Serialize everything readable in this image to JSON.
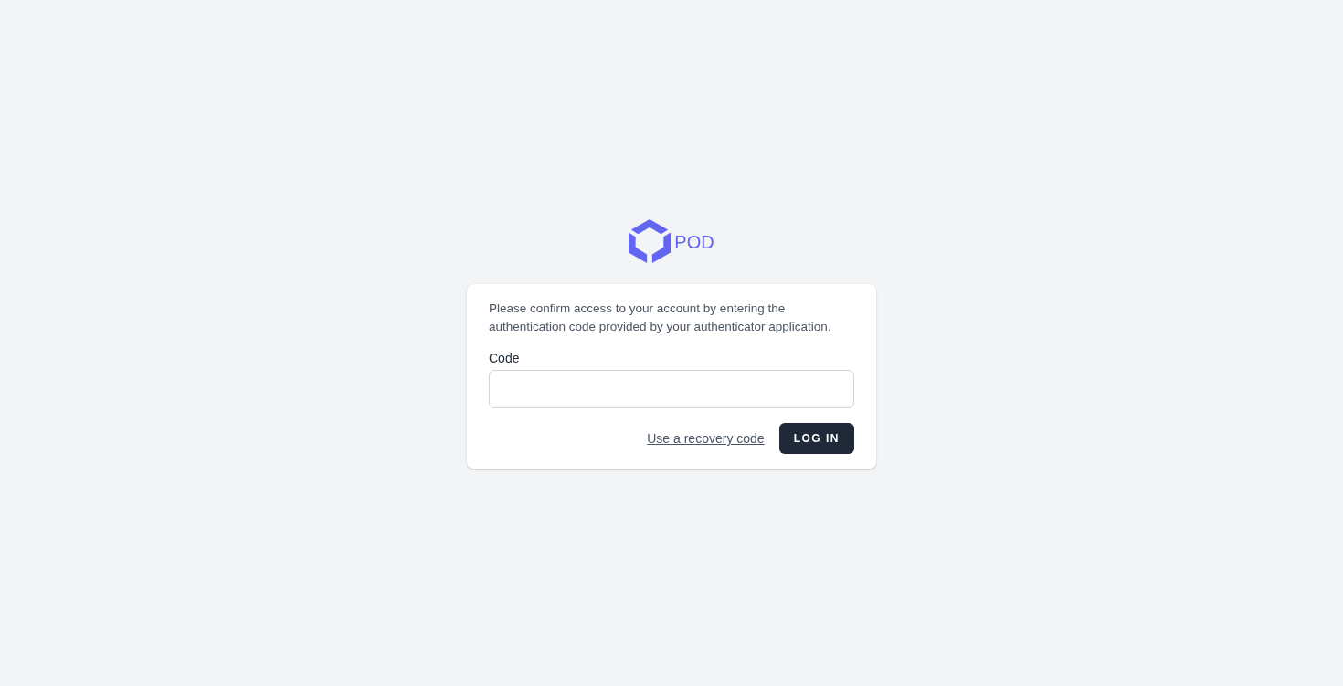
{
  "logo": {
    "text": "POD"
  },
  "card": {
    "message": "Please confirm access to your account by entering the authentication code provided by your authenticator application.",
    "code_field": {
      "label": "Code"
    },
    "recovery_link": "Use a recovery code",
    "submit_button": "LOG IN"
  }
}
